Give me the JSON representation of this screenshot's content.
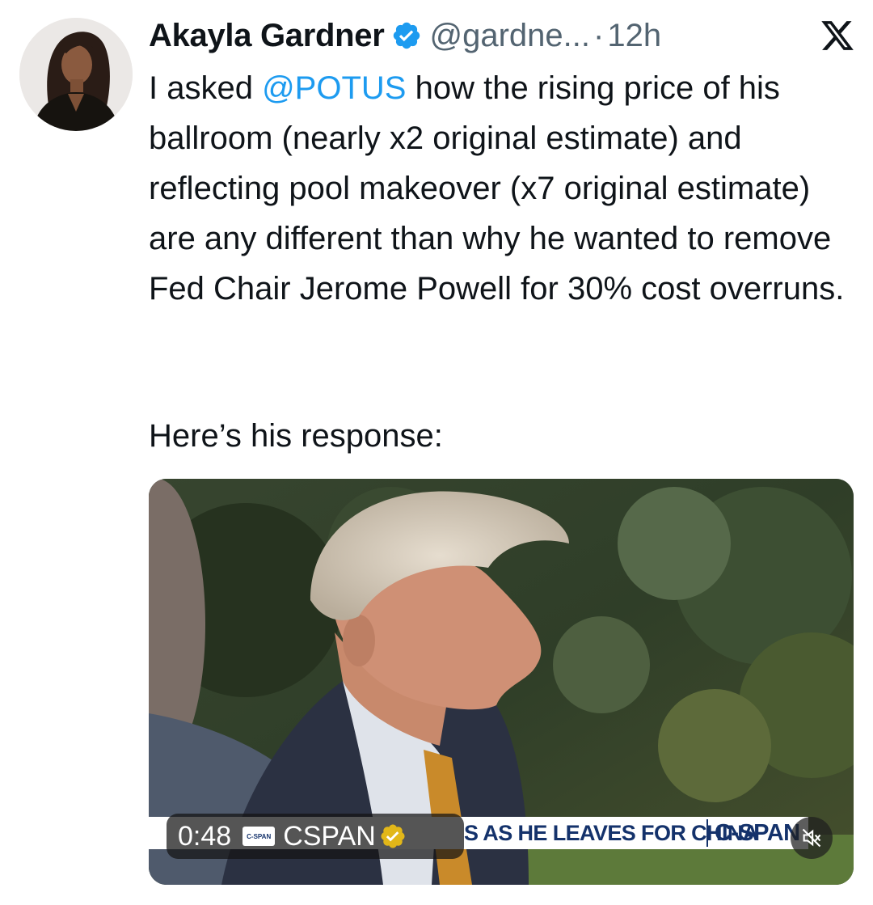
{
  "author": {
    "name": "Akayla Gardner",
    "handle": "@gardne...",
    "separator": "·",
    "time": "12h"
  },
  "tweet": {
    "text_pre": "I asked ",
    "mention": "@POTUS",
    "text_post": " how the rising price of his ballroom (nearly x2 original estimate) and reflecting pool makeover (x7 original estimate) are any different than why he wanted to remove Fed Chair Jerome Powell for 30% cost overruns.",
    "second_paragraph": "Here’s his response:"
  },
  "video": {
    "duration": "0:48",
    "channel_badge": "C-SPAN",
    "channel_name": "CSPAN",
    "chyron_text": "S AS HE LEAVES FOR CHINA",
    "chyron_logo": "C-SPAN"
  },
  "colors": {
    "mention": "#1d9bf0",
    "verified": "#1d9bf0",
    "secondary_text": "#536471",
    "chyron_text": "#14326b",
    "gold_badge": "#e2b719"
  },
  "icons": {
    "verified": "verified-badge-icon",
    "brand": "x-logo-icon",
    "gold": "gold-verified-badge-icon",
    "mute": "muted-speaker-icon"
  }
}
